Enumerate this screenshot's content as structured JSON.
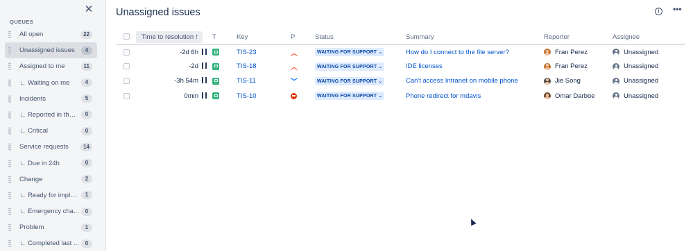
{
  "sidebar": {
    "close_icon": "✕",
    "section_label": "QUEUES",
    "queues": [
      {
        "label": "All open",
        "count": "22",
        "active": false
      },
      {
        "label": "Unassigned issues",
        "count": "4",
        "active": true
      },
      {
        "label": "Assigned to me",
        "count": "11",
        "active": false
      },
      {
        "label": "∟ Waiting on me",
        "count": "4",
        "active": false
      },
      {
        "label": "Incidents",
        "count": "5",
        "active": false
      },
      {
        "label": "∟ Reported in the l...",
        "count": "0",
        "active": false
      },
      {
        "label": "∟ Critical",
        "count": "0",
        "active": false
      },
      {
        "label": "Service requests",
        "count": "14",
        "active": false
      },
      {
        "label": "∟ Due in 24h",
        "count": "0",
        "active": false
      },
      {
        "label": "Change",
        "count": "2",
        "active": false
      },
      {
        "label": "∟ Ready for imple...",
        "count": "1",
        "active": false
      },
      {
        "label": "∟ Emergency cha...",
        "count": "0",
        "active": false
      },
      {
        "label": "Problem",
        "count": "1",
        "active": false
      },
      {
        "label": "∟ Completed last ...",
        "count": "0",
        "active": false
      }
    ]
  },
  "main": {
    "title": "Unassigned issues",
    "info_icon": "i",
    "more_icon": "•••"
  },
  "table": {
    "headers": {
      "time_to_resolution": "Time to resolution",
      "sort_arrow": "↑",
      "type": "T",
      "key": "Key",
      "priority": "P",
      "status": "Status",
      "summary": "Summary",
      "reporter": "Reporter",
      "assignee": "Assignee"
    },
    "rows": [
      {
        "ttr": "-2d 6h",
        "key": "TIS-23",
        "priority": "high",
        "priority_icon": "︿",
        "status": "WAITING FOR SUPPORT ⌄",
        "summary": "How do I connect to the file server?",
        "reporter": "Fran Perez",
        "reporter_avatar_color": "#c0712f",
        "assignee": "Unassigned"
      },
      {
        "ttr": "-2d",
        "key": "TIS-18",
        "priority": "high",
        "priority_icon": "︿",
        "status": "WAITING FOR SUPPORT ⌄",
        "summary": "IDE licenses",
        "reporter": "Fran Perez",
        "reporter_avatar_color": "#c0712f",
        "assignee": "Unassigned"
      },
      {
        "ttr": "-3h 54m",
        "key": "TIS-11",
        "priority": "low",
        "priority_icon": "﹀",
        "status": "WAITING FOR SUPPORT ⌄",
        "summary": "Can't access Intranet on mobile phone",
        "reporter": "Jie Song",
        "reporter_avatar_color": "#4a4a4a",
        "assignee": "Unassigned"
      },
      {
        "ttr": "0min",
        "key": "TIS-10",
        "priority": "blocker",
        "priority_icon": "",
        "status": "WAITING FOR SUPPORT ⌄",
        "summary": "Phone redirect for mdavis",
        "reporter": "Omar Darboe",
        "reporter_avatar_color": "#6b4a2f",
        "assignee": "Unassigned"
      }
    ]
  },
  "colors": {
    "link": "#0052cc",
    "status_bg": "#deebff",
    "status_text": "#0747a6",
    "type_icon": "#36b37e"
  }
}
